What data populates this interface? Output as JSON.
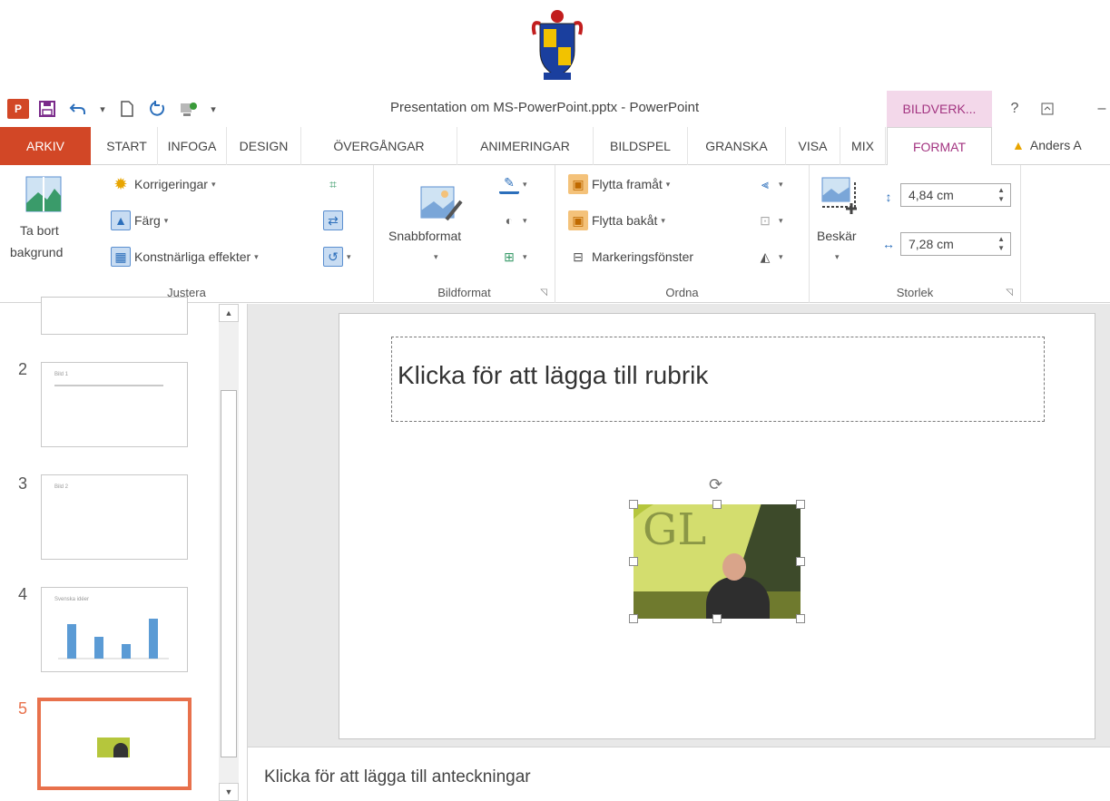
{
  "titlebar": {
    "document_title": "Presentation om MS-PowerPoint.pptx - PowerPoint",
    "context_tab": "BILDVERK...",
    "app_badge": "P",
    "help": "?",
    "minimize": "–"
  },
  "tabs": [
    "ARKIV",
    "START",
    "INFOGA",
    "DESIGN",
    "ÖVERGÅNGAR",
    "ANIMERINGAR",
    "BILDSPEL",
    "GRANSKA",
    "VISA",
    "MIX",
    "FORMAT"
  ],
  "user": "Anders A",
  "ribbon": {
    "remove_bg_line1": "Ta bort",
    "remove_bg_line2": "bakgrund",
    "corrections": "Korrigeringar",
    "color": "Färg",
    "artistic": "Konstnärliga effekter",
    "group_adjust": "Justera",
    "quick_styles": "Snabbformat",
    "group_picture_styles": "Bildformat",
    "bring_forward": "Flytta framåt",
    "send_backward": "Flytta bakåt",
    "selection_pane": "Markeringsfönster",
    "group_arrange": "Ordna",
    "crop": "Beskär",
    "height": "4,84 cm",
    "width": "7,28 cm",
    "group_size": "Storlek"
  },
  "thumbnails": [
    {
      "num": "2",
      "title": "Bild 1"
    },
    {
      "num": "3",
      "title": "Bild 2"
    },
    {
      "num": "4",
      "title": "Svenska idéer"
    },
    {
      "num": "5",
      "title": ""
    }
  ],
  "slide": {
    "title_placeholder": "Klicka för att lägga till rubrik"
  },
  "notes_placeholder": "Klicka för att lägga till anteckningar",
  "colors": {
    "accent": "#d24726",
    "format_tab": "#a33481",
    "selection": "#e8714c"
  }
}
